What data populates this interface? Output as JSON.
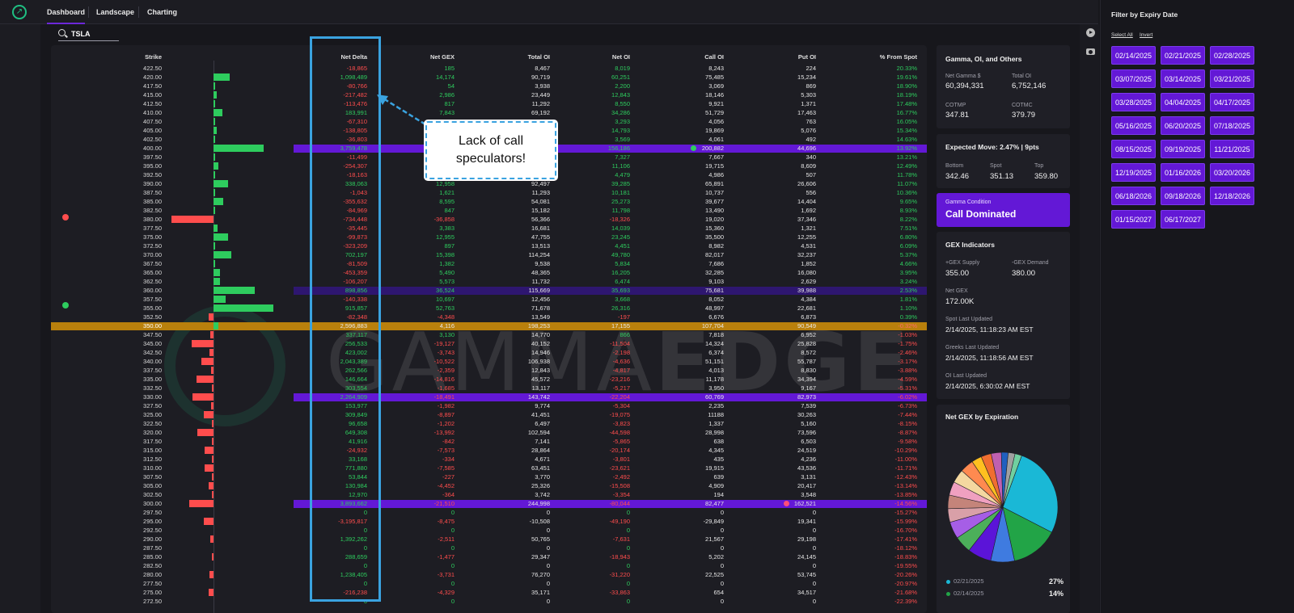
{
  "nav": {
    "tabs": [
      "Dashboard",
      "Landscape",
      "Charting"
    ]
  },
  "search": {
    "value": "TSLA"
  },
  "table": {
    "headers": {
      "strike": "Strike",
      "net_delta": "Net Delta",
      "net_gex": "Net GEX",
      "total_oi": "Total OI",
      "net_oi": "Net OI",
      "call_oi": "Call OI",
      "put_oi": "Put OI",
      "pct_from_spot": "% From Spot"
    },
    "rows": [
      {
        "strike": "422.50",
        "nd": "-18,865",
        "ng": "185",
        "toi": "8,467",
        "noi": "8,019",
        "coi": "8,243",
        "poi": "224",
        "pct": "20.33%",
        "bar": 0
      },
      {
        "strike": "420.00",
        "nd": "1,098,489",
        "ng": "14,174",
        "toi": "90,719",
        "noi": "60,251",
        "coi": "75,485",
        "poi": "15,234",
        "pct": "19.61%",
        "bar": 14174
      },
      {
        "strike": "417.50",
        "nd": "-80,766",
        "ng": "54",
        "toi": "3,938",
        "noi": "2,200",
        "coi": "3,069",
        "poi": "869",
        "pct": "18.90%",
        "bar": 54
      },
      {
        "strike": "415.00",
        "nd": "-217,482",
        "ng": "2,986",
        "toi": "23,449",
        "noi": "12,843",
        "coi": "18,146",
        "poi": "5,303",
        "pct": "18.19%",
        "bar": 2986
      },
      {
        "strike": "412.50",
        "nd": "-113,476",
        "ng": "817",
        "toi": "11,292",
        "noi": "8,550",
        "coi": "9,921",
        "poi": "1,371",
        "pct": "17.48%",
        "bar": 817
      },
      {
        "strike": "410.00",
        "nd": "183,991",
        "ng": "7,843",
        "toi": "69,192",
        "noi": "34,286",
        "coi": "51,729",
        "poi": "17,463",
        "pct": "16.77%",
        "bar": 7843
      },
      {
        "strike": "407.50",
        "nd": "-67,310",
        "ng": "",
        "toi": "",
        "noi": "3,293",
        "coi": "4,056",
        "poi": "763",
        "pct": "16.05%",
        "bar": 700
      },
      {
        "strike": "405.00",
        "nd": "-138,805",
        "ng": "",
        "toi": "",
        "noi": "14,793",
        "coi": "19,869",
        "poi": "5,076",
        "pct": "15.34%",
        "bar": 3000
      },
      {
        "strike": "402.50",
        "nd": "-36,803",
        "ng": "",
        "toi": "",
        "noi": "3,569",
        "coi": "4,061",
        "poi": "492",
        "pct": "14.63%",
        "bar": 700
      },
      {
        "strike": "400.00",
        "nd": "3,759,478",
        "ng": "",
        "toi": "",
        "noi": "156,186",
        "coi": "200,882",
        "poi": "44,696",
        "pct": "13.92%",
        "bar": 44000,
        "hl": "purple"
      },
      {
        "strike": "397.50",
        "nd": "-11,499",
        "ng": "",
        "toi": "",
        "noi": "7,327",
        "coi": "7,667",
        "poi": "340",
        "pct": "13.21%",
        "bar": 300
      },
      {
        "strike": "395.00",
        "nd": "-254,307",
        "ng": "",
        "toi": "",
        "noi": "11,106",
        "coi": "19,715",
        "poi": "8,609",
        "pct": "12.49%",
        "bar": 4000
      },
      {
        "strike": "392.50",
        "nd": "-18,163",
        "ng": "",
        "toi": "",
        "noi": "4,479",
        "coi": "4,986",
        "poi": "507",
        "pct": "11.78%",
        "bar": 1000
      },
      {
        "strike": "390.00",
        "nd": "338,063",
        "ng": "12,958",
        "toi": "92,497",
        "noi": "39,285",
        "coi": "65,891",
        "poi": "26,606",
        "pct": "11.07%",
        "bar": 12958
      },
      {
        "strike": "387.50",
        "nd": "-1,043",
        "ng": "1,621",
        "toi": "11,293",
        "noi": "10,181",
        "coi": "10,737",
        "poi": "556",
        "pct": "10.36%",
        "bar": 1621
      },
      {
        "strike": "385.00",
        "nd": "-355,632",
        "ng": "8,595",
        "toi": "54,081",
        "noi": "25,273",
        "coi": "39,677",
        "poi": "14,404",
        "pct": "9.65%",
        "bar": 8595
      },
      {
        "strike": "382.50",
        "nd": "-84,969",
        "ng": "847",
        "toi": "15,182",
        "noi": "11,798",
        "coi": "13,490",
        "poi": "1,692",
        "pct": "8.93%",
        "bar": 847
      },
      {
        "strike": "380.00",
        "nd": "-734,448",
        "ng": "-36,858",
        "toi": "56,366",
        "noi": "-18,326",
        "coi": "19,020",
        "poi": "37,346",
        "pct": "8.22%",
        "bar": -36858
      },
      {
        "strike": "377.50",
        "nd": "-35,445",
        "ng": "3,383",
        "toi": "16,681",
        "noi": "14,039",
        "coi": "15,360",
        "poi": "1,321",
        "pct": "7.51%",
        "bar": 3383
      },
      {
        "strike": "375.00",
        "nd": "-99,873",
        "ng": "12,955",
        "toi": "47,755",
        "noi": "23,245",
        "coi": "35,500",
        "poi": "12,255",
        "pct": "6.80%",
        "bar": 12955
      },
      {
        "strike": "372.50",
        "nd": "-323,209",
        "ng": "897",
        "toi": "13,513",
        "noi": "4,451",
        "coi": "8,982",
        "poi": "4,531",
        "pct": "6.09%",
        "bar": 897
      },
      {
        "strike": "370.00",
        "nd": "702,197",
        "ng": "15,398",
        "toi": "114,254",
        "noi": "49,780",
        "coi": "82,017",
        "poi": "32,237",
        "pct": "5.37%",
        "bar": 15398
      },
      {
        "strike": "367.50",
        "nd": "-81,509",
        "ng": "1,382",
        "toi": "9,538",
        "noi": "5,834",
        "coi": "7,686",
        "poi": "1,852",
        "pct": "4.66%",
        "bar": 1382
      },
      {
        "strike": "365.00",
        "nd": "-453,359",
        "ng": "5,490",
        "toi": "48,365",
        "noi": "16,205",
        "coi": "32,285",
        "poi": "16,080",
        "pct": "3.95%",
        "bar": 5490
      },
      {
        "strike": "362.50",
        "nd": "-106,207",
        "ng": "5,573",
        "toi": "11,732",
        "noi": "6,474",
        "coi": "9,103",
        "poi": "2,629",
        "pct": "3.24%",
        "bar": 5573
      },
      {
        "strike": "360.00",
        "nd": "898,856",
        "ng": "36,524",
        "toi": "115,669",
        "noi": "35,693",
        "coi": "75,681",
        "poi": "39,988",
        "pct": "2.53%",
        "bar": 36524,
        "hl": "dark"
      },
      {
        "strike": "357.50",
        "nd": "-140,338",
        "ng": "10,697",
        "toi": "12,456",
        "noi": "3,668",
        "coi": "8,052",
        "poi": "4,384",
        "pct": "1.81%",
        "bar": 10697
      },
      {
        "strike": "355.00",
        "nd": "915,857",
        "ng": "52,763",
        "toi": "71,678",
        "noi": "26,316",
        "coi": "48,997",
        "poi": "22,681",
        "pct": "1.10%",
        "bar": 52763
      },
      {
        "strike": "352.50",
        "nd": "-82,348",
        "ng": "-4,348",
        "toi": "13,549",
        "noi": "-197",
        "coi": "6,676",
        "poi": "6,873",
        "pct": "0.39%",
        "bar": -4348
      },
      {
        "strike": "350.00",
        "nd": "2,596,883",
        "ng": "4,116",
        "toi": "198,253",
        "noi": "17,155",
        "coi": "107,704",
        "poi": "90,549",
        "pct": "-0.32%",
        "bar": 4116,
        "hl": "orange"
      },
      {
        "strike": "347.50",
        "nd": "337,117",
        "ng": "3,130",
        "toi": "14,770",
        "noi": "866",
        "coi": "7,818",
        "poi": "6,952",
        "pct": "-1.03%",
        "bar": -3130
      },
      {
        "strike": "345.00",
        "nd": "256,533",
        "ng": "-19,127",
        "toi": "40,152",
        "noi": "-11,504",
        "coi": "14,324",
        "poi": "25,828",
        "pct": "-1.75%",
        "bar": -19127
      },
      {
        "strike": "342.50",
        "nd": "423,002",
        "ng": "-3,743",
        "toi": "14,946",
        "noi": "-2,198",
        "coi": "6,374",
        "poi": "8,572",
        "pct": "-2.46%",
        "bar": -3743
      },
      {
        "strike": "340.00",
        "nd": "2,043,389",
        "ng": "-10,522",
        "toi": "106,938",
        "noi": "-4,636",
        "coi": "51,151",
        "poi": "55,787",
        "pct": "-3.17%",
        "bar": -10522
      },
      {
        "strike": "337.50",
        "nd": "262,566",
        "ng": "-2,359",
        "toi": "12,843",
        "noi": "-4,817",
        "coi": "4,013",
        "poi": "8,830",
        "pct": "-3.88%",
        "bar": -2359
      },
      {
        "strike": "335.00",
        "nd": "146,664",
        "ng": "-14,816",
        "toi": "45,572",
        "noi": "-23,216",
        "coi": "11,178",
        "poi": "34,394",
        "pct": "-4.59%",
        "bar": -14816
      },
      {
        "strike": "332.50",
        "nd": "303,554",
        "ng": "-1,685",
        "toi": "13,117",
        "noi": "-5,217",
        "coi": "3,950",
        "poi": "9,167",
        "pct": "-5.31%",
        "bar": -1685
      },
      {
        "strike": "330.00",
        "nd": "2,264,909",
        "ng": "-18,491",
        "toi": "143,742",
        "noi": "-22,204",
        "coi": "60,769",
        "poi": "82,973",
        "pct": "-6.02%",
        "bar": -18491,
        "hl": "purple"
      },
      {
        "strike": "327.50",
        "nd": "153,977",
        "ng": "-1,982",
        "toi": "9,774",
        "noi": "-5,304",
        "coi": "2,235",
        "poi": "7,539",
        "pct": "-6.73%",
        "bar": -1982
      },
      {
        "strike": "325.00",
        "nd": "309,849",
        "ng": "-8,897",
        "toi": "41,451",
        "noi": "-19,075",
        "coi": "11188",
        "poi": "30,263",
        "pct": "-7.44%",
        "bar": -8897
      },
      {
        "strike": "322.50",
        "nd": "96,658",
        "ng": "-1,202",
        "toi": "6,497",
        "noi": "-3,823",
        "coi": "1,337",
        "poi": "5,160",
        "pct": "-8.15%",
        "bar": -1202
      },
      {
        "strike": "320.00",
        "nd": "649,308",
        "ng": "-13,992",
        "toi": "102,594",
        "noi": "-44,598",
        "coi": "28,998",
        "poi": "73,596",
        "pct": "-8.87%",
        "bar": -13992
      },
      {
        "strike": "317.50",
        "nd": "41,916",
        "ng": "-842",
        "toi": "7,141",
        "noi": "-5,865",
        "coi": "638",
        "poi": "6,503",
        "pct": "-9.58%",
        "bar": -842
      },
      {
        "strike": "315.00",
        "nd": "-24,932",
        "ng": "-7,573",
        "toi": "28,864",
        "noi": "-20,174",
        "coi": "4,345",
        "poi": "24,519",
        "pct": "-10.29%",
        "bar": -7573
      },
      {
        "strike": "312.50",
        "nd": "33,168",
        "ng": "-334",
        "toi": "4,671",
        "noi": "-3,801",
        "coi": "435",
        "poi": "4,236",
        "pct": "-11.00%",
        "bar": -334
      },
      {
        "strike": "310.00",
        "nd": "771,880",
        "ng": "-7,585",
        "toi": "63,451",
        "noi": "-23,621",
        "coi": "19,915",
        "poi": "43,536",
        "pct": "-11.71%",
        "bar": -7585
      },
      {
        "strike": "307.50",
        "nd": "53,844",
        "ng": "-227",
        "toi": "3,770",
        "noi": "-2,492",
        "coi": "639",
        "poi": "3,131",
        "pct": "-12.43%",
        "bar": -227
      },
      {
        "strike": "305.00",
        "nd": "130,984",
        "ng": "-4,452",
        "toi": "25,326",
        "noi": "-15,508",
        "coi": "4,909",
        "poi": "20,417",
        "pct": "-13.14%",
        "bar": -4452
      },
      {
        "strike": "302.50",
        "nd": "12,970",
        "ng": "-364",
        "toi": "3,742",
        "noi": "-3,354",
        "coi": "194",
        "poi": "3,548",
        "pct": "-13.85%",
        "bar": -364
      },
      {
        "strike": "300.00",
        "nd": "3,893,662",
        "ng": "-21,510",
        "toi": "244,998",
        "noi": "-80,044",
        "coi": "82,477",
        "poi": "162,521",
        "pct": "-14.56%",
        "bar": -21510,
        "hl": "purple"
      },
      {
        "strike": "297.50",
        "nd": "0",
        "ng": "0",
        "toi": "0",
        "noi": "0",
        "coi": "0",
        "poi": "0",
        "pct": "-15.27%",
        "bar": 0
      },
      {
        "strike": "295.00",
        "nd": "-3,195,817",
        "ng": "-8,475",
        "toi": "-10,508",
        "noi": "-49,190",
        "coi": "-29,849",
        "poi": "19,341",
        "pct": "-15.99%",
        "bar": -8475
      },
      {
        "strike": "292.50",
        "nd": "0",
        "ng": "0",
        "toi": "0",
        "noi": "0",
        "coi": "0",
        "poi": "0",
        "pct": "-16.70%",
        "bar": 0
      },
      {
        "strike": "290.00",
        "nd": "1,392,262",
        "ng": "-2,511",
        "toi": "50,765",
        "noi": "-7,631",
        "coi": "21,567",
        "poi": "29,198",
        "pct": "-17.41%",
        "bar": -2511
      },
      {
        "strike": "287.50",
        "nd": "0",
        "ng": "0",
        "toi": "0",
        "noi": "0",
        "coi": "0",
        "poi": "0",
        "pct": "-18.12%",
        "bar": 0
      },
      {
        "strike": "285.00",
        "nd": "288,659",
        "ng": "-1,477",
        "toi": "29,347",
        "noi": "-18,943",
        "coi": "5,202",
        "poi": "24,145",
        "pct": "-18.83%",
        "bar": -1477
      },
      {
        "strike": "282.50",
        "nd": "0",
        "ng": "0",
        "toi": "0",
        "noi": "0",
        "coi": "0",
        "poi": "0",
        "pct": "-19.55%",
        "bar": 0
      },
      {
        "strike": "280.00",
        "nd": "1,238,405",
        "ng": "-3,731",
        "toi": "76,270",
        "noi": "-31,220",
        "coi": "22,525",
        "poi": "53,745",
        "pct": "-20.26%",
        "bar": -3731
      },
      {
        "strike": "277.50",
        "nd": "0",
        "ng": "0",
        "toi": "0",
        "noi": "0",
        "coi": "0",
        "poi": "0",
        "pct": "-20.97%",
        "bar": 0
      },
      {
        "strike": "275.00",
        "nd": "-216,238",
        "ng": "-4,329",
        "toi": "35,171",
        "noi": "-33,863",
        "coi": "654",
        "poi": "34,517",
        "pct": "-21.68%",
        "bar": -4329
      },
      {
        "strike": "272.50",
        "nd": "0",
        "ng": "0",
        "toi": "0",
        "noi": "0",
        "coi": "0",
        "poi": "0",
        "pct": "-22.39%",
        "bar": 0
      }
    ]
  },
  "annotation": {
    "line1": "Lack of call",
    "line2": "speculators!"
  },
  "watermark": {
    "part1": "GAMMA",
    "part2": "EDGE"
  },
  "gamma_card": {
    "title": "Gamma, OI, and Others",
    "net_gamma_label": "Net Gamma $",
    "net_gamma": "60,394,331",
    "total_oi_label": "Total OI",
    "total_oi": "6,752,146",
    "cotmp_label": "COTMP",
    "cotmp": "347.81",
    "cotmc_label": "COTMC",
    "cotmc": "379.79"
  },
  "expected_move": {
    "title": "Expected Move: 2.47% | 9pts",
    "bottom_label": "Bottom",
    "bottom": "342.46",
    "spot_label": "Spot",
    "spot": "351.13",
    "top_label": "Top",
    "top": "359.80"
  },
  "gamma_condition": {
    "label": "Gamma Condition",
    "value": "Call Dominated"
  },
  "gex_indicators": {
    "title": "GEX Indicators",
    "supply_label": "+GEX Supply",
    "supply": "355.00",
    "demand_label": "-GEX Demand",
    "demand": "380.00",
    "net_label": "Net GEX",
    "net": "172.00K",
    "spot_updated_label": "Spot Last Updated",
    "spot_updated": "2/14/2025, 11:18:23 AM EST",
    "greeks_updated_label": "Greeks Last Updated",
    "greeks_updated": "2/14/2025, 11:18:56 AM EST",
    "oi_updated_label": "OI Last Updated",
    "oi_updated": "2/14/2025, 6:30:02 AM EST"
  },
  "pie": {
    "title": "Net GEX by Expiration",
    "legend": [
      {
        "label": "02/21/2025",
        "pct": "27%",
        "color": "#1ab8d6"
      },
      {
        "label": "02/14/2025",
        "pct": "14%",
        "color": "#22a447"
      }
    ]
  },
  "chart_data": {
    "type": "pie",
    "title": "Net GEX by Expiration",
    "slices": [
      {
        "label": "02/21/2025",
        "value": 27,
        "color": "#1ab8d6"
      },
      {
        "label": "02/14/2025",
        "value": 14,
        "color": "#22a447"
      },
      {
        "label": "",
        "value": 7,
        "color": "#3f7be0"
      },
      {
        "label": "",
        "value": 7,
        "color": "#5b14d8"
      },
      {
        "label": "",
        "value": 5,
        "color": "#4caf5a"
      },
      {
        "label": "",
        "value": 5,
        "color": "#a65ee6"
      },
      {
        "label": "",
        "value": 4,
        "color": "#d9a0a8"
      },
      {
        "label": "",
        "value": 4,
        "color": "#c4847a"
      },
      {
        "label": "",
        "value": 4,
        "color": "#f0a0c0"
      },
      {
        "label": "",
        "value": 4,
        "color": "#f4d8a0"
      },
      {
        "label": "",
        "value": 4,
        "color": "#ff8a50"
      },
      {
        "label": "",
        "value": 3,
        "color": "#ffc020"
      },
      {
        "label": "",
        "value": 3,
        "color": "#f06e30"
      },
      {
        "label": "",
        "value": 3,
        "color": "#c060b0"
      },
      {
        "label": "",
        "value": 2,
        "color": "#2060c0"
      },
      {
        "label": "",
        "value": 2,
        "color": "#a0a0a0"
      },
      {
        "label": "",
        "value": 2,
        "color": "#70d0a0"
      }
    ]
  },
  "filter": {
    "title": "Filter by Expiry Date",
    "select_all": "Select All",
    "invert": "Invert",
    "dates": [
      "02/14/2025",
      "02/21/2025",
      "02/28/2025",
      "03/07/2025",
      "03/14/2025",
      "03/21/2025",
      "03/28/2025",
      "04/04/2025",
      "04/17/2025",
      "05/16/2025",
      "06/20/2025",
      "07/18/2025",
      "08/15/2025",
      "09/19/2025",
      "11/21/2025",
      "12/19/2025",
      "01/16/2026",
      "03/20/2026",
      "06/18/2026",
      "09/18/2026",
      "12/18/2026",
      "01/15/2027",
      "06/17/2027"
    ]
  },
  "colors": {
    "green": "#2ecc5e",
    "red": "#ff4d4d",
    "purple": "#6318d6",
    "orange": "#b9800c",
    "annotation": "#3aa3e0"
  }
}
